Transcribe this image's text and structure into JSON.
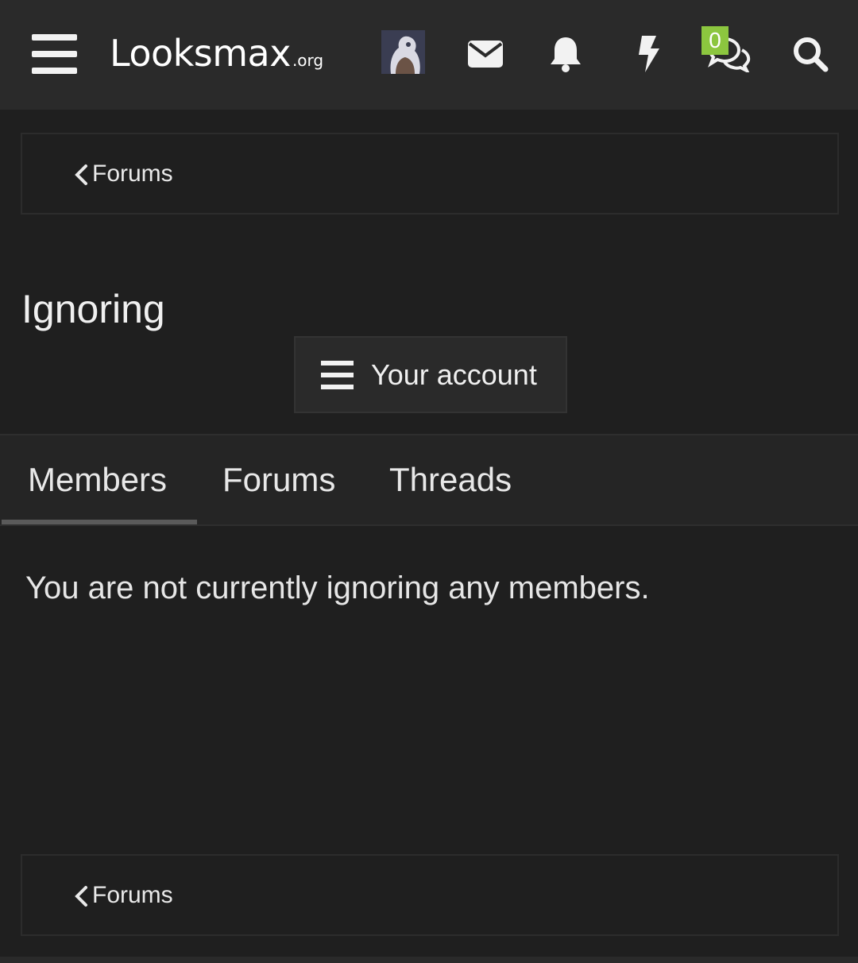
{
  "header": {
    "logo_main": "Looksmax",
    "logo_tld": ".org",
    "conversations_badge": "0",
    "colors": {
      "bar_bg": "#2a2a2a",
      "badge_bg": "#8cc63f",
      "icon": "#f2f2f2"
    },
    "icons": [
      "menu-icon",
      "envelope-icon",
      "bell-icon",
      "lightning-icon",
      "chat-bubbles-icon",
      "search-icon"
    ]
  },
  "breadcrumb": {
    "top_label": "Forums",
    "bottom_label": "Forums"
  },
  "page": {
    "title": "Ignoring",
    "account_button_label": "Your account"
  },
  "tabs": {
    "items": [
      {
        "label": "Members",
        "active": true
      },
      {
        "label": "Forums",
        "active": false
      },
      {
        "label": "Threads",
        "active": false
      }
    ]
  },
  "content": {
    "empty_message": "You are not currently ignoring any members."
  }
}
